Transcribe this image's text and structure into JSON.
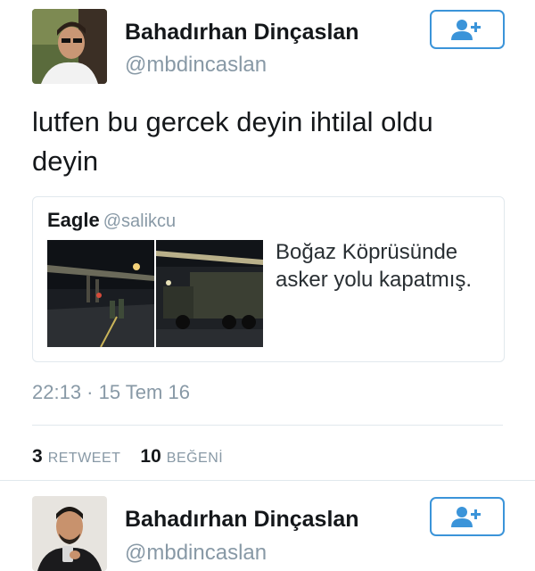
{
  "tweet": {
    "author": {
      "name": "Bahadırhan Dinçaslan",
      "handle": "@mbdincaslan"
    },
    "text": "lutfen bu gercek deyin ihtilal oldu deyin",
    "quoted": {
      "name": "Eagle",
      "handle": "@salikcu",
      "text": "Boğaz Köprüsünde asker yolu kapatmış."
    },
    "timestamp": "22:13 · 15 Tem 16",
    "stats": {
      "retweets_count": "3",
      "retweets_label": "RETWEET",
      "likes_count": "10",
      "likes_label": "BEĞENİ"
    }
  },
  "next_tweet": {
    "author": {
      "name": "Bahadırhan Dinçaslan",
      "handle": "@mbdincaslan"
    }
  },
  "icons": {
    "follow": "add-user-icon"
  },
  "colors": {
    "accent": "#3b94d9",
    "muted": "#8899a6",
    "border": "#e1e8ed",
    "text": "#14171a"
  }
}
